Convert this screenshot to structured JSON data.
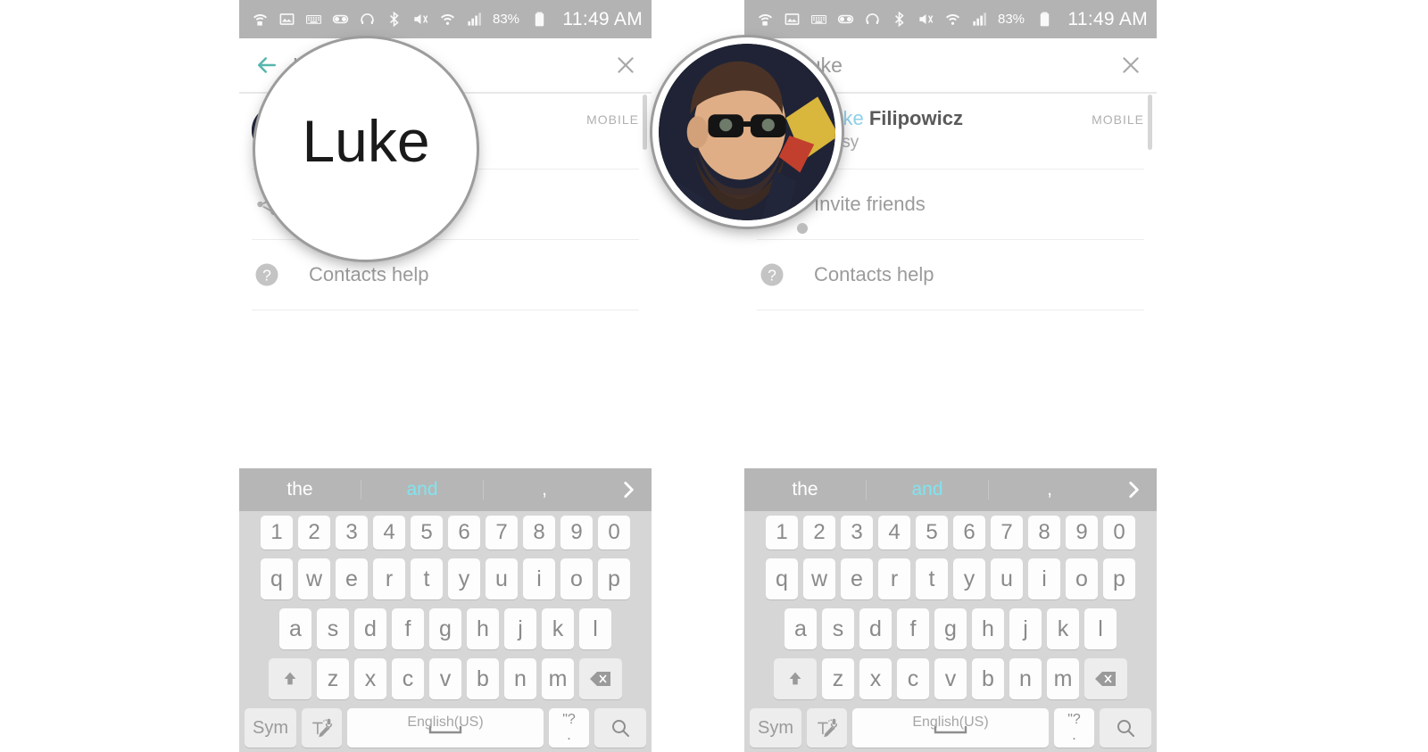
{
  "statusbar": {
    "battery_percent": "83%",
    "time": "11:49 AM",
    "icons": [
      "wifi-transfer-icon",
      "image-icon",
      "keyboard-icon",
      "voicemail-icon",
      "headphones-icon",
      "bluetooth-icon",
      "mute-vibrate-icon",
      "wifi-icon",
      "signal-bars-icon",
      "battery-icon"
    ]
  },
  "panel_left": {
    "header": {
      "back_label": "back-arrow",
      "search_value": "Luke",
      "close_label": "close"
    },
    "contact": {
      "name_highlight": "Luke",
      "name_rest": " Filipowicz",
      "status": "Busy",
      "meta": "MOBILE"
    },
    "menu": [
      {
        "icon": "share-icon",
        "label": "Invite friends"
      },
      {
        "icon": "help-icon",
        "label": "Contacts help"
      }
    ],
    "magnifier": {
      "zoom_text": "Luke",
      "target": "search-field"
    }
  },
  "panel_right": {
    "header": {
      "search_value": "Luke",
      "close_label": "close"
    },
    "contact": {
      "name_highlight": "Luke",
      "name_rest": " Filipowicz",
      "status": "Busy",
      "meta": "MOBILE"
    },
    "menu": [
      {
        "icon": "share-icon",
        "label": "Invite friends"
      },
      {
        "icon": "help-icon",
        "label": "Contacts help"
      }
    ],
    "magnifier": {
      "target": "contact-avatar"
    }
  },
  "keyboard": {
    "suggestions": [
      {
        "text": "the",
        "active": false
      },
      {
        "text": "and",
        "active": true
      },
      {
        "text": ",",
        "active": false
      }
    ],
    "next_icon": "chevron-right-icon",
    "rows": {
      "numbers": [
        "1",
        "2",
        "3",
        "4",
        "5",
        "6",
        "7",
        "8",
        "9",
        "0"
      ],
      "top": [
        "q",
        "w",
        "e",
        "r",
        "t",
        "y",
        "u",
        "i",
        "o",
        "p"
      ],
      "home": [
        "a",
        "s",
        "d",
        "f",
        "g",
        "h",
        "j",
        "k",
        "l"
      ],
      "bottom": [
        "z",
        "x",
        "c",
        "v",
        "b",
        "n",
        "m"
      ]
    },
    "shift_icon": "shift-up-icon",
    "backspace_icon": "backspace-icon",
    "sym_label": "Sym",
    "handwriting_icon": "handwriting-mic-icon",
    "space_label": "English(US)",
    "punct_label": "\"?",
    "punct_sub": ".",
    "search_icon": "search-icon"
  },
  "colors": {
    "statusbar_bg": "#b3b3b3",
    "suggestion_bg": "#b6b6b6",
    "suggestion_active": "#7fe4ef",
    "keyboard_bg": "#d6d6d6",
    "key_bg": "#fdfdfd",
    "key_fn_bg": "#ededed",
    "accent_teal": "#57b6ad",
    "name_highlight": "#8ed0ea",
    "text_muted": "#9b9b9b"
  }
}
